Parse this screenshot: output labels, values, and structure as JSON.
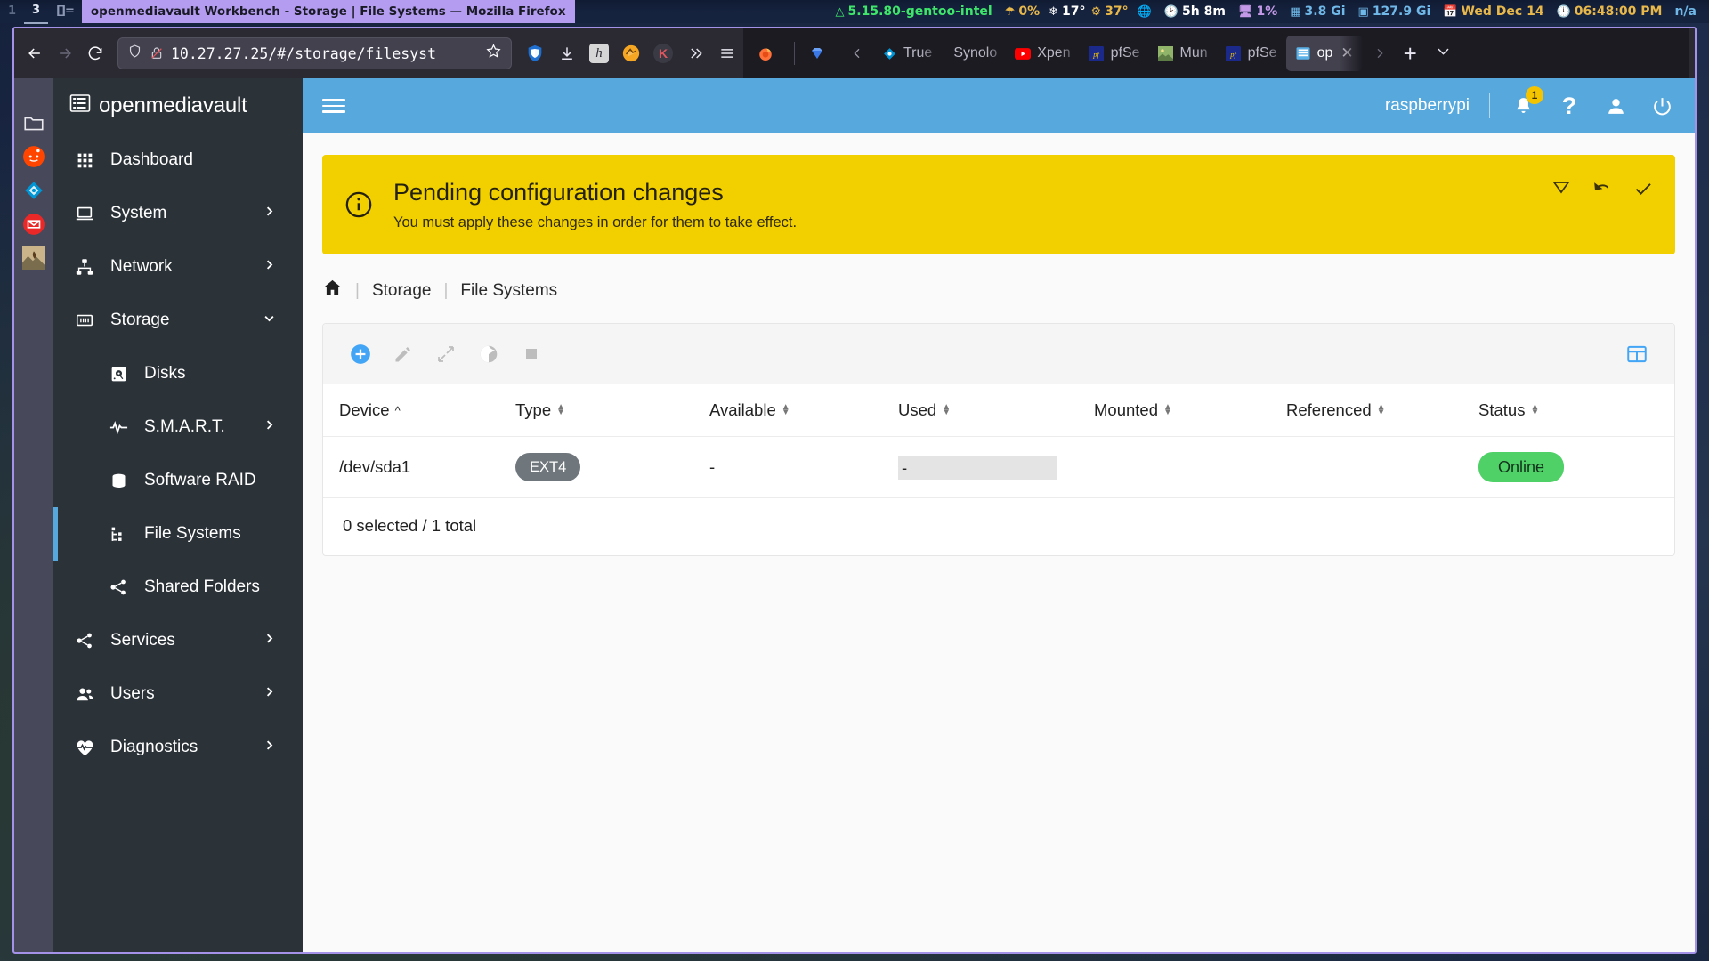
{
  "statusbar": {
    "workspaces": [
      {
        "label": "1",
        "state": "inactive"
      },
      {
        "label": "3",
        "state": "active"
      },
      {
        "label": "[]=",
        "state": "layout"
      }
    ],
    "window_title": "openmediavault Workbench - Storage | File Systems — Mozilla Firefox",
    "items": [
      {
        "name": "kernel",
        "icon": "gentoo-icon",
        "text": "5.15.80-gentoo-intel",
        "color": "#3ee66a"
      },
      {
        "name": "rain",
        "icon": "umbrella-icon",
        "text": "0%",
        "color": "#e8b84a"
      },
      {
        "name": "temp-low",
        "icon": "snowflake-icon",
        "text": "17°",
        "color": "#ffffff"
      },
      {
        "name": "temp-high",
        "icon": "sun-icon",
        "text": "37°",
        "color": "#e8b84a"
      },
      {
        "name": "network",
        "icon": "globe-icon",
        "text": "",
        "color": "#6fb8e8"
      },
      {
        "name": "uptime",
        "icon": "uptime-icon",
        "text": "5h 8m",
        "color": "#ffffff"
      },
      {
        "name": "cpu",
        "icon": "monitor-icon",
        "text": "1%",
        "color": "#c49ae8"
      },
      {
        "name": "memory",
        "icon": "memory-icon",
        "text": "3.8 Gi",
        "color": "#6fb8e8"
      },
      {
        "name": "disk",
        "icon": "disk-icon",
        "text": "127.9 Gi",
        "color": "#6fb8e8"
      },
      {
        "name": "date",
        "icon": "calendar-icon",
        "text": "Wed Dec 14",
        "color": "#e8b84a"
      },
      {
        "name": "time",
        "icon": "clock-icon",
        "text": "06:48:00 PM",
        "color": "#e8b84a"
      },
      {
        "name": "battery",
        "icon": "battery-icon",
        "text": "n/a",
        "color": "#6fb8e8"
      }
    ]
  },
  "browser": {
    "back_label": "Back",
    "forward_label": "Forward",
    "reload_label": "Reload",
    "url": "10.27.27.25/#/storage/filesyst",
    "bookmark_label": "Bookmark this page",
    "extensions": [
      {
        "name": "ublock-origin-icon",
        "label": "uBlock Origin"
      },
      {
        "name": "downloads-icon",
        "label": "Downloads"
      },
      {
        "name": "hoxx-icon",
        "label": "h"
      },
      {
        "name": "videodownload-icon",
        "label": "Video DownloadHelper"
      },
      {
        "name": "keepa-icon",
        "label": "K"
      },
      {
        "name": "overflow-icon",
        "label": "»"
      },
      {
        "name": "app-menu-icon",
        "label": "Open application menu"
      }
    ],
    "tabs": [
      {
        "name": "tab-firefox",
        "favicon": "firefox-icon",
        "label": "",
        "active": false
      },
      {
        "name": "tab-diamond",
        "favicon": "diamond-icon",
        "label": "",
        "active": false
      },
      {
        "name": "tab-scroll-left",
        "favicon": "chevron-left-icon",
        "label": "",
        "active": false
      },
      {
        "name": "tab-truenas",
        "favicon": "truenas-icon",
        "label": "True",
        "active": false
      },
      {
        "name": "tab-synology",
        "favicon": "",
        "label": "Synolo",
        "active": false
      },
      {
        "name": "tab-xpenology",
        "favicon": "youtube-icon",
        "label": "Xpen",
        "active": false
      },
      {
        "name": "tab-pfsense-1",
        "favicon": "pfsense-icon",
        "label": "pfSe",
        "active": false
      },
      {
        "name": "tab-munich",
        "favicon": "photo-icon",
        "label": "Mun",
        "active": false
      },
      {
        "name": "tab-pfsense-2",
        "favicon": "pfsense-icon",
        "label": "pfSe",
        "active": false
      },
      {
        "name": "tab-openmediavault",
        "favicon": "omv-icon",
        "label": "op",
        "active": true
      }
    ],
    "new_tab_label": "+",
    "list_tabs_label": "List all tabs"
  },
  "dock": {
    "items": [
      {
        "name": "dock-files",
        "icon": "folder-icon"
      },
      {
        "name": "dock-reddit",
        "icon": "reddit-icon"
      },
      {
        "name": "dock-truenas",
        "icon": "truenas-icon"
      },
      {
        "name": "dock-gmail",
        "icon": "gmail-icon"
      },
      {
        "name": "dock-gallery",
        "icon": "photo-icon"
      }
    ]
  },
  "sidebar": {
    "brand": "openmediavault",
    "items": [
      {
        "label": "Dashboard",
        "icon": "grid-icon",
        "level": 0,
        "expandable": false,
        "selected": false
      },
      {
        "label": "System",
        "icon": "laptop-icon",
        "level": 0,
        "expandable": true,
        "expanded": false,
        "selected": false
      },
      {
        "label": "Network",
        "icon": "network-icon",
        "level": 0,
        "expandable": true,
        "expanded": false,
        "selected": false
      },
      {
        "label": "Storage",
        "icon": "storage-icon",
        "level": 0,
        "expandable": true,
        "expanded": true,
        "selected": false
      },
      {
        "label": "Disks",
        "icon": "disk-icon",
        "level": 1,
        "expandable": false,
        "selected": false
      },
      {
        "label": "S.M.A.R.T.",
        "icon": "pulse-icon",
        "level": 1,
        "expandable": true,
        "expanded": false,
        "selected": false
      },
      {
        "label": "Software RAID",
        "icon": "raid-icon",
        "level": 1,
        "expandable": false,
        "selected": false
      },
      {
        "label": "File Systems",
        "icon": "filesystem-icon",
        "level": 1,
        "expandable": false,
        "selected": true
      },
      {
        "label": "Shared Folders",
        "icon": "share-icon",
        "level": 1,
        "expandable": false,
        "selected": false
      },
      {
        "label": "Services",
        "icon": "share-icon",
        "level": 0,
        "expandable": true,
        "expanded": false,
        "selected": false
      },
      {
        "label": "Users",
        "icon": "users-icon",
        "level": 0,
        "expandable": true,
        "expanded": false,
        "selected": false
      },
      {
        "label": "Diagnostics",
        "icon": "heartbeat-icon",
        "level": 0,
        "expandable": true,
        "expanded": false,
        "selected": false
      }
    ]
  },
  "topbar": {
    "menu_label": "Toggle navigation",
    "username": "raspberrypi",
    "notification_count": "1",
    "help_label": "?",
    "account_label": "Account",
    "power_label": "Power"
  },
  "banner": {
    "title": "Pending configuration changes",
    "subtitle": "You must apply these changes in order for them to take effect.",
    "bg_color": "#f2d000",
    "actions": [
      {
        "name": "show-pending-button",
        "icon": "filter-icon"
      },
      {
        "name": "revert-changes-button",
        "icon": "undo-icon"
      },
      {
        "name": "apply-changes-button",
        "icon": "check-icon"
      }
    ]
  },
  "breadcrumb": {
    "home_label": "Home",
    "items": [
      "Storage",
      "File Systems"
    ]
  },
  "toolbar": {
    "buttons": [
      {
        "name": "create-button",
        "icon": "plus-circle-icon",
        "enabled": true
      },
      {
        "name": "edit-button",
        "icon": "pencil-icon",
        "enabled": false
      },
      {
        "name": "resize-button",
        "icon": "expand-icon",
        "enabled": false
      },
      {
        "name": "quota-button",
        "icon": "pie-chart-icon",
        "enabled": false
      },
      {
        "name": "unmount-button",
        "icon": "stop-icon",
        "enabled": false
      }
    ],
    "column_select_label": "Select columns"
  },
  "table": {
    "columns": [
      {
        "label": "Device",
        "sort": "asc"
      },
      {
        "label": "Type",
        "sort": "none"
      },
      {
        "label": "Available",
        "sort": "none"
      },
      {
        "label": "Used",
        "sort": "none"
      },
      {
        "label": "Mounted",
        "sort": "none"
      },
      {
        "label": "Referenced",
        "sort": "none"
      },
      {
        "label": "Status",
        "sort": "none"
      }
    ],
    "rows": [
      {
        "device": "/dev/sda1",
        "type": "EXT4",
        "available": "-",
        "used": "-",
        "used_bar": true,
        "mounted": "",
        "referenced": "",
        "status": "Online",
        "status_color": "#4fd167"
      }
    ],
    "footer": "0 selected / 1 total"
  }
}
